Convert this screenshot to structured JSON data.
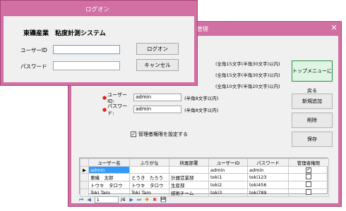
{
  "user_mgmt": {
    "title": "ユーザー管理",
    "hints": [
      "(全角15文字(半角30文字)以内)",
      "(全角15文字(半角30文字)以内)",
      "(全角10文字(半角20文字)以内)"
    ],
    "fields": [
      {
        "label": "ユーザーID:",
        "value": "admin",
        "hint": "(半角8文字以内)"
      },
      {
        "label": "パスワード:",
        "value": "admin",
        "hint": "(半角8文字以内)"
      }
    ],
    "admin_checkbox": {
      "label": "管理者権限を設定する",
      "checked": true
    },
    "buttons": {
      "top_menu": "トップメニューに戻る",
      "new": "新規追加",
      "delete": "削除",
      "save": "保存"
    },
    "grid": {
      "headers": [
        "ユーザー名",
        "ふりがな",
        "所属部署",
        "ユーザーID",
        "パスワード",
        "管理者権限"
      ],
      "rows": [
        {
          "current": true,
          "name": "admin",
          "furigana": "",
          "dept": "",
          "id": "admin",
          "password": "admin",
          "admin": true
        },
        {
          "current": false,
          "name": "東磯　太郎",
          "furigana": "とうき　たろう",
          "dept": "計器営業部",
          "id": "toki1",
          "password": "toki123",
          "admin": false
        },
        {
          "current": false,
          "name": "トウキ　タロウ",
          "furigana": "トウキ　タロウ",
          "dept": "生産部",
          "id": "toki2",
          "password": "toki456",
          "admin": false
        },
        {
          "current": false,
          "name": "Toki Taro",
          "furigana": "Toki Taro",
          "dept": "技術チーム",
          "id": "toki3",
          "password": "toki789",
          "admin": false
        }
      ]
    },
    "navigator": {
      "position": "1",
      "of": "/4"
    }
  },
  "login": {
    "title": "ログオン",
    "system_title": "東磯産業　粘度計測システム",
    "user_label": "ユーザーID",
    "password_label": "パスワード",
    "user_value": "",
    "password_value": "",
    "logon_button": "ログオン",
    "cancel_button": "キャンセル"
  },
  "icons": {
    "first": "⏮",
    "prev": "◀",
    "next": "▶",
    "last": "⏭",
    "add": "✚",
    "delete": "✖",
    "save": "💾",
    "row_indicator": "▶",
    "close": "✕",
    "check": "✓"
  },
  "colors": {
    "title_bar": "#d26fa3",
    "selection": "#3399ff",
    "required": "#e02020",
    "top_menu_border": "#2c8f3d"
  }
}
